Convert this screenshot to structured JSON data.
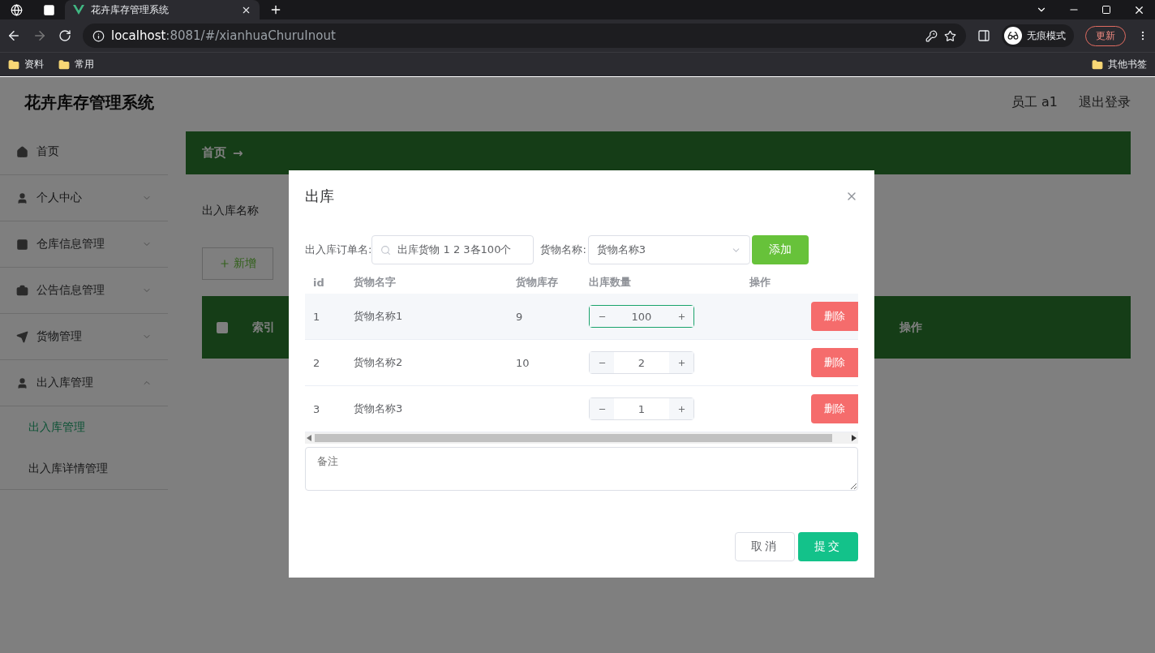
{
  "browser": {
    "tabs": [
      {
        "title": "花卉库存管理系统",
        "selected": true
      }
    ],
    "url_host": "localhost",
    "url_path": ":8081/#/xianhuaChuruInout",
    "profile": "无痕模式",
    "update_button": "更新",
    "bookmarks": [
      "资料",
      "常用"
    ],
    "other_bookmarks": "其他书签"
  },
  "header": {
    "title": "花卉库存管理系统",
    "user": "员工 a1",
    "logout": "退出登录"
  },
  "sidebar": {
    "items": [
      {
        "label": "首页"
      },
      {
        "label": "个人中心",
        "expanded": false
      },
      {
        "label": "仓库信息管理",
        "expanded": false
      },
      {
        "label": "公告信息管理",
        "expanded": false
      },
      {
        "label": "货物管理",
        "expanded": false
      },
      {
        "label": "出入库管理",
        "expanded": true,
        "children": [
          {
            "label": "出入库管理",
            "selected": true
          },
          {
            "label": "出入库详情管理",
            "selected": false
          }
        ]
      }
    ]
  },
  "breadcrumb": {
    "home": "首页",
    "arrow": "→"
  },
  "search": {
    "label": "出入库名称"
  },
  "add_button": "新增",
  "table": {
    "select_all_checked": false,
    "columns": [
      "索引",
      "操作"
    ]
  },
  "dialog": {
    "title": "出库",
    "order_label": "出入库订单名:",
    "order_value": "出库货物 1 2 3各100个",
    "goods_label": "货物名称:",
    "goods_value": "货物名称3",
    "add_button": "添加",
    "columns": [
      "id",
      "货物名字",
      "货物库存",
      "出库数量",
      "操作"
    ],
    "rows": [
      {
        "id": "1",
        "name": "货物名称1",
        "stock": "9",
        "quantity": "100",
        "focused": true,
        "delete": "删除"
      },
      {
        "id": "2",
        "name": "货物名称2",
        "stock": "10",
        "quantity": "2",
        "focused": false,
        "delete": "删除"
      },
      {
        "id": "3",
        "name": "货物名称3",
        "quantity": "1",
        "focused": false,
        "delete": "删除"
      }
    ],
    "remark_placeholder": "备注",
    "cancel": "取消",
    "submit": "提交"
  }
}
